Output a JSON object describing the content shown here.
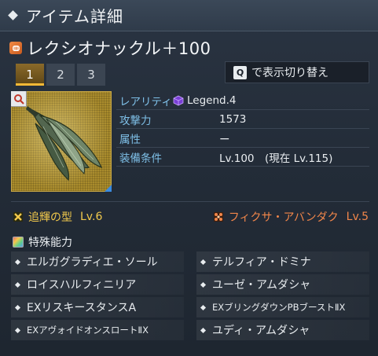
{
  "window": {
    "title": "アイテム詳細"
  },
  "item": {
    "name": "レクシオナックル＋100",
    "type_icon": "knuckle-icon"
  },
  "tabs": [
    {
      "label": "1",
      "active": true
    },
    {
      "label": "2",
      "active": false
    },
    {
      "label": "3",
      "active": false
    }
  ],
  "toggle": {
    "key": "Q",
    "label": "で表示切り替え"
  },
  "stats": {
    "rarity_label": "レアリティ",
    "rarity_value": "Legend.4",
    "attack_label": "攻撃力",
    "attack_value": "1573",
    "element_label": "属性",
    "element_value": "ー",
    "requirement_label": "装備条件",
    "requirement_value": "Lv.100　(現在 Lv.115)"
  },
  "augments": {
    "left": {
      "name": "追輝の型",
      "level": "Lv.6",
      "color": "#f2c94c"
    },
    "right": {
      "name": "フィクサ・アバンダク",
      "level": "Lv.5",
      "color": "#f2864a"
    }
  },
  "special": {
    "title": "特殊能力",
    "abilities": [
      "エルガグラディエ・ソール",
      "テルフィア・ドミナ",
      "ロイスハルフィニリア",
      "ユーゼ・アムダシャ",
      "EXリスキースタンスA",
      "EXブリングダウンPBブーストⅡX",
      "EXアヴォイドオンスロートⅡX",
      "ユディ・アムダシャ"
    ]
  },
  "colors": {
    "accent": "#f4b936",
    "label": "#7fc0e8",
    "rarity": "#8a4de0"
  }
}
